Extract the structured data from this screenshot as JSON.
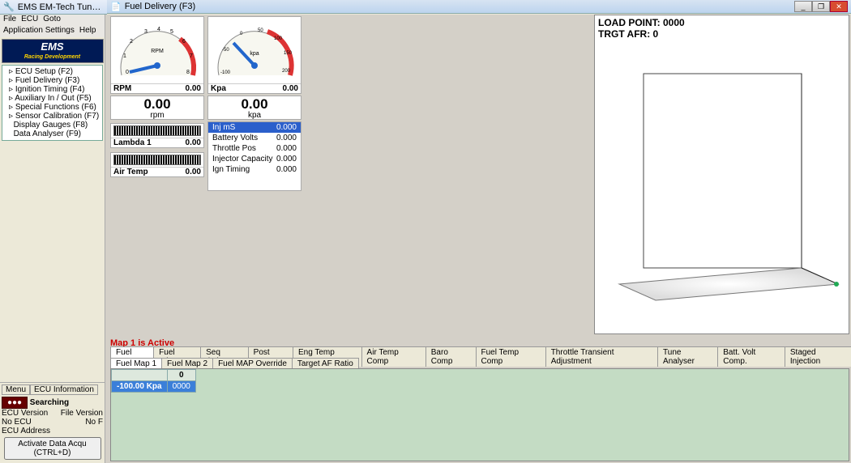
{
  "main_title": "EMS EM-Tech Tun…",
  "main_menu": [
    "File",
    "ECU",
    "Goto"
  ],
  "main_menu2": [
    "Application Settings",
    "Help"
  ],
  "logo_top": "EMS",
  "logo_bot": "Racing Development",
  "tree": [
    "ECU Setup (F2)",
    "Fuel Delivery (F3)",
    "Ignition Timing (F4)",
    "Auxiliary In / Out (F5)",
    "Special Functions (F6)",
    "Sensor Calibration (F7)",
    "Display Gauges (F8)",
    "Data Analyser (F9)"
  ],
  "status_tabs": [
    "Menu",
    "ECU Information"
  ],
  "status_searching": "Searching",
  "status_lines": [
    "ECU Version",
    "No ECU",
    "ECU Address",
    "File Version",
    "No F"
  ],
  "activate": "Activate Data Acqu (CTRL+D)",
  "child_title": "Fuel Delivery (F3)",
  "gauges": {
    "rpm": {
      "label": "RPM",
      "value": "0.00",
      "unit": "rpm",
      "ticks": [
        "0",
        "1",
        "2",
        "3",
        "4",
        "5",
        "6",
        "7",
        "8"
      ],
      "caption": "RPM"
    },
    "kpa": {
      "label": "Kpa",
      "value": "0.00",
      "unit": "kpa",
      "ticks": [
        "-100",
        "-50",
        "0",
        "50",
        "100",
        "150",
        "200"
      ],
      "caption": "kpa"
    }
  },
  "bars": [
    {
      "label": "Lambda 1",
      "value": "0.00"
    },
    {
      "label": "Air Temp",
      "value": "0.00"
    }
  ],
  "big": [
    {
      "value": "0.00",
      "unit": "rpm"
    },
    {
      "value": "0.00",
      "unit": "kpa"
    }
  ],
  "readouts": [
    {
      "name": "Inj mS",
      "value": "0.000",
      "sel": true
    },
    {
      "name": "Battery Volts",
      "value": "0.000"
    },
    {
      "name": "Throttle Pos",
      "value": "0.000"
    },
    {
      "name": "Injector Capacity",
      "value": "0.000"
    },
    {
      "name": "Ign Timing",
      "value": "0.000"
    }
  ],
  "map_caption": "Map 1 is Active",
  "tabs1": [
    "Fuel Map",
    "Fuel Trims",
    "Seq timing",
    "Post Start",
    "Eng Temp Comp",
    "Air Temp Comp",
    "Baro Comp",
    "Fuel Temp Comp",
    "Throttle Transient Adjustment",
    "Tune Analyser",
    "Batt. Volt Comp.",
    "Staged Injection"
  ],
  "tabs2": [
    "Fuel Map 1",
    "Fuel Map 2",
    "Fuel  MAP Override",
    "Target AF Ratio"
  ],
  "grid": {
    "col": "0",
    "row": "-100.00 Kpa",
    "cell": "0000"
  },
  "overlay": {
    "load": "LOAD POINT: 0000",
    "afr": "TRGT AFR: 0"
  }
}
